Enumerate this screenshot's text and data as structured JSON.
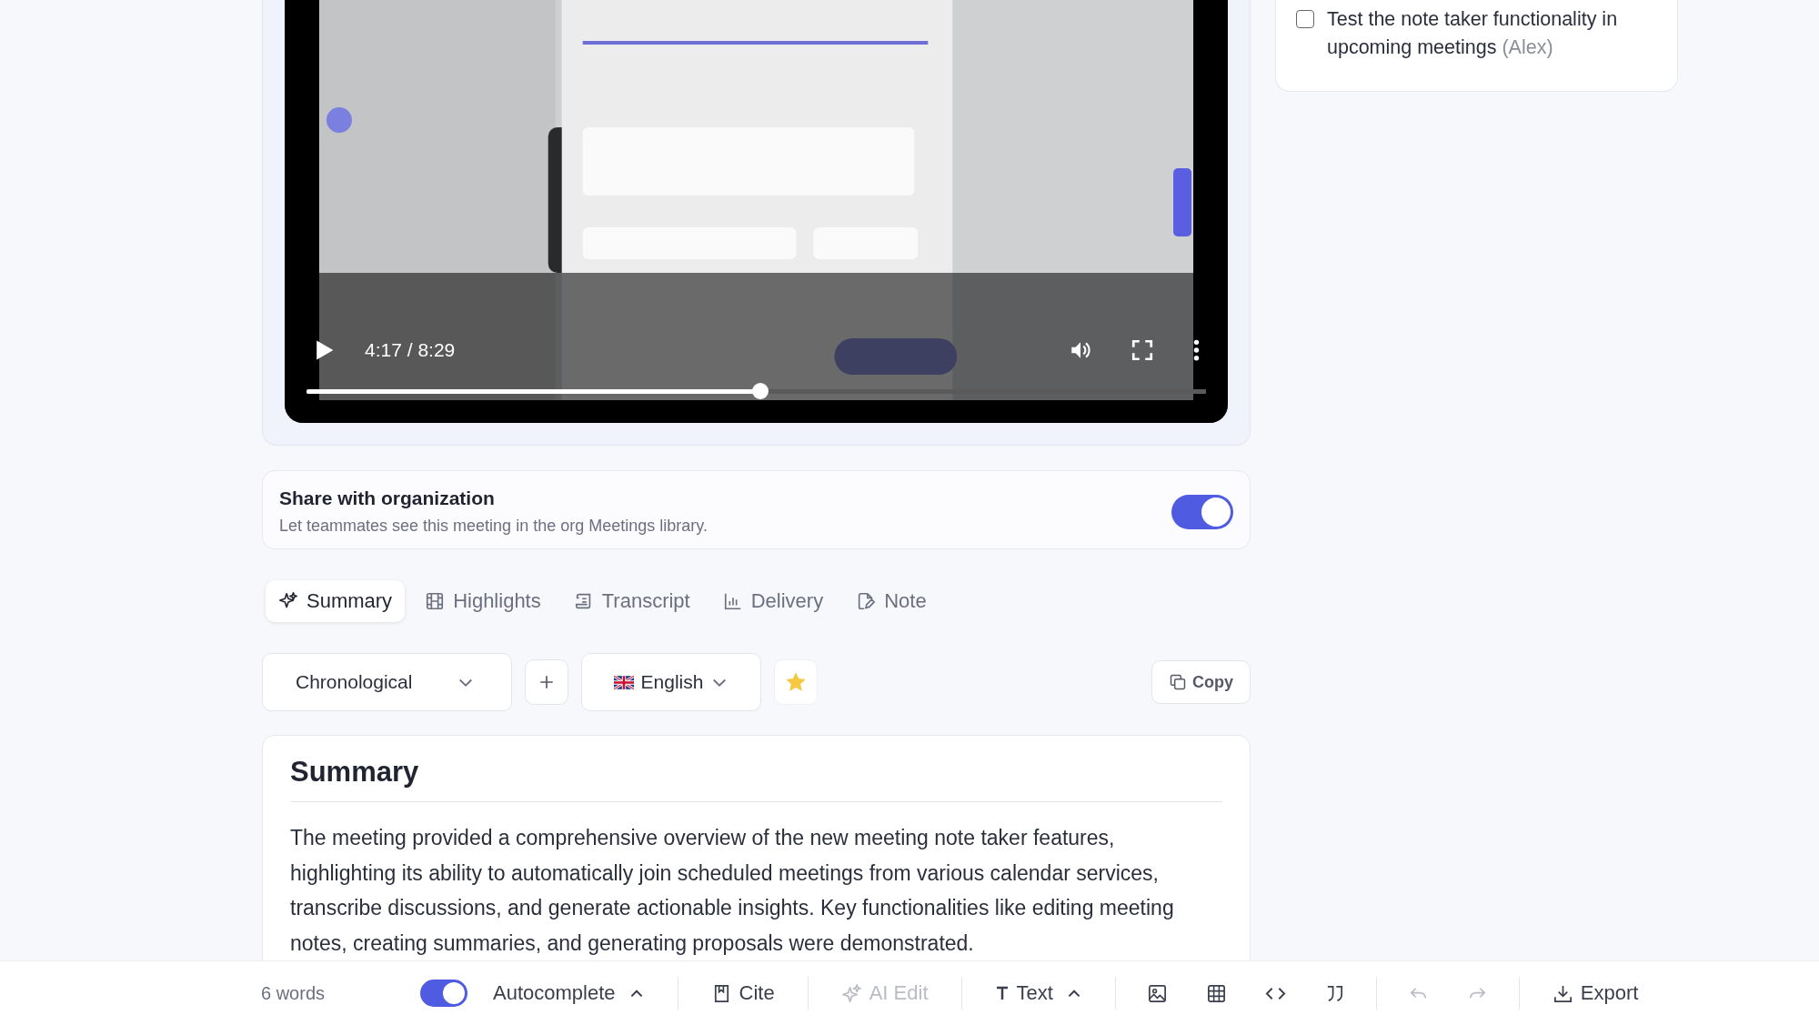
{
  "video": {
    "time": "4:17 / 8:29",
    "progress": {
      "level": 0.505
    }
  },
  "share": {
    "title": "Share with organization",
    "description": "Let teammates see this meeting in the org Meetings library.",
    "on": true
  },
  "tabs": [
    {
      "label": "Summary",
      "selected": true
    },
    {
      "label": "Highlights",
      "selected": false
    },
    {
      "label": "Transcript",
      "selected": false
    },
    {
      "label": "Delivery",
      "selected": false
    },
    {
      "label": "Note",
      "selected": false
    }
  ],
  "controls": {
    "order": "Chronological",
    "language": "English",
    "starred": true,
    "copy": "Copy"
  },
  "summary": {
    "heading": "Summary",
    "text": "The meeting provided a comprehensive overview of the new meeting note taker features, highlighting its ability to automatically join scheduled meetings from various calendar services, transcribe discussions, and generate actionable insights. Key functionalities like editing meeting notes, creating summaries, and generating proposals were demonstrated."
  },
  "action_items": [
    {
      "text": "Test the note taker functionality in upcoming meetings",
      "owner": "(Alex)",
      "checked": false
    }
  ],
  "toolbar": {
    "word_count": "6 words",
    "autocomplete": {
      "label": "Autocomplete",
      "on": true
    },
    "cite": {
      "label": "Cite",
      "disabled": false
    },
    "ai_edit": {
      "label": "AI Edit",
      "disabled": true
    },
    "text_style": {
      "label": "Text"
    },
    "undo": {
      "disabled": true
    },
    "redo": {
      "disabled": true
    },
    "export": "Export"
  }
}
